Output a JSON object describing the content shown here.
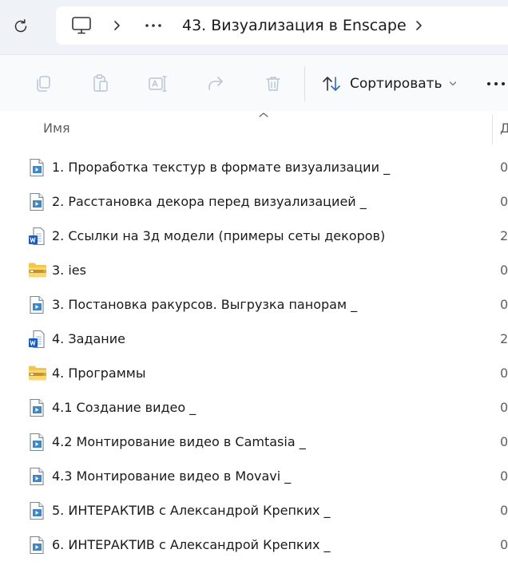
{
  "addressbar": {
    "refresh_icon": "refresh-icon",
    "pc_icon": "monitor-icon",
    "more_icon": "ellipsis-icon",
    "current_folder": "43. Визуализация в Enscape"
  },
  "toolbar": {
    "copy_icon": "copy-icon",
    "paste_icon": "paste-icon",
    "rename_icon": "rename-icon",
    "share_icon": "share-icon",
    "delete_icon": "trash-icon",
    "sort_icon": "sort-arrows-icon",
    "sort_label": "Сортировать",
    "more_icon": "ellipsis-icon"
  },
  "columns": {
    "name": "Имя",
    "date": "Д"
  },
  "colors": {
    "addressbar_bg": "#eff3f8",
    "toolbar_bg": "#f9fafc",
    "video_icon": "#3a87c9",
    "word_icon": "#185abd",
    "folder_icon": "#f3c54b"
  },
  "files": [
    {
      "name": "1. Проработка текстур в формате визуализации _",
      "type": "video",
      "date": "0"
    },
    {
      "name": "2. Расстановка декора перед визуализацией _",
      "type": "video",
      "date": "0"
    },
    {
      "name": "2. Ссылки на 3д модели (примеры сеты декоров)",
      "type": "word",
      "date": "2"
    },
    {
      "name": "3. ies",
      "type": "zip-folder",
      "date": "0"
    },
    {
      "name": "3. Постановка ракурсов. Выгрузка панорам _",
      "type": "video",
      "date": "0"
    },
    {
      "name": "4. Задание",
      "type": "word",
      "date": "2"
    },
    {
      "name": "4. Программы",
      "type": "zip-folder",
      "date": "0"
    },
    {
      "name": "4.1 Создание видео _",
      "type": "video",
      "date": "0"
    },
    {
      "name": "4.2 Монтирование видео в Camtasia _",
      "type": "video",
      "date": "0"
    },
    {
      "name": "4.3 Монтирование видео в Movavi _",
      "type": "video",
      "date": "0"
    },
    {
      "name": "5. ИНТЕРАКТИВ с Александрой Крепких _",
      "type": "video",
      "date": "0"
    },
    {
      "name": "6. ИНТЕРАКТИВ с Александрой Крепких _",
      "type": "video",
      "date": "0"
    }
  ]
}
